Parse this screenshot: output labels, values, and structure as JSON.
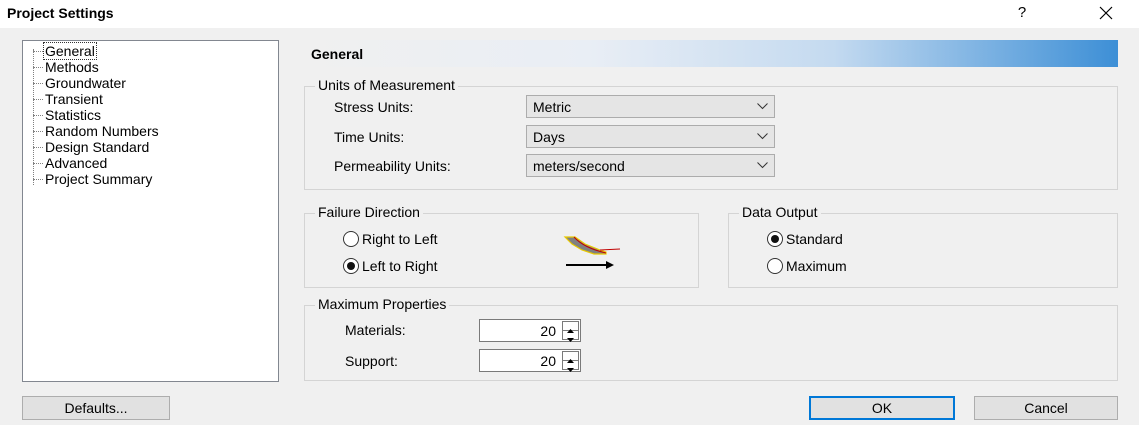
{
  "window": {
    "title": "Project Settings",
    "help_label": "?",
    "close_label": "✕"
  },
  "tree": {
    "items": [
      "General",
      "Methods",
      "Groundwater",
      "Transient",
      "Statistics",
      "Random Numbers",
      "Design Standard",
      "Advanced",
      "Project Summary"
    ],
    "selected": "General"
  },
  "panel": {
    "header": "General",
    "units": {
      "legend": "Units of Measurement",
      "stress_label": "Stress Units:",
      "stress_value": "Metric",
      "time_label": "Time Units:",
      "time_value": "Days",
      "perm_label": "Permeability Units:",
      "perm_value": "meters/second"
    },
    "failure": {
      "legend": "Failure Direction",
      "option1": "Right to Left",
      "option2": "Left to Right",
      "selected": "Left to Right"
    },
    "output": {
      "legend": "Data Output",
      "option1": "Standard",
      "option2": "Maximum",
      "selected": "Standard"
    },
    "maxprops": {
      "legend": "Maximum Properties",
      "materials_label": "Materials:",
      "materials_value": "20",
      "support_label": "Support:",
      "support_value": "20"
    }
  },
  "buttons": {
    "defaults": "Defaults...",
    "ok": "OK",
    "cancel": "Cancel"
  },
  "colors": {
    "accent": "#0078d7",
    "header_gradient_end": "#3d8fd6",
    "slope_fill": "#808080",
    "slope_outline": "#e8c800",
    "slip_line": "#c00000"
  }
}
